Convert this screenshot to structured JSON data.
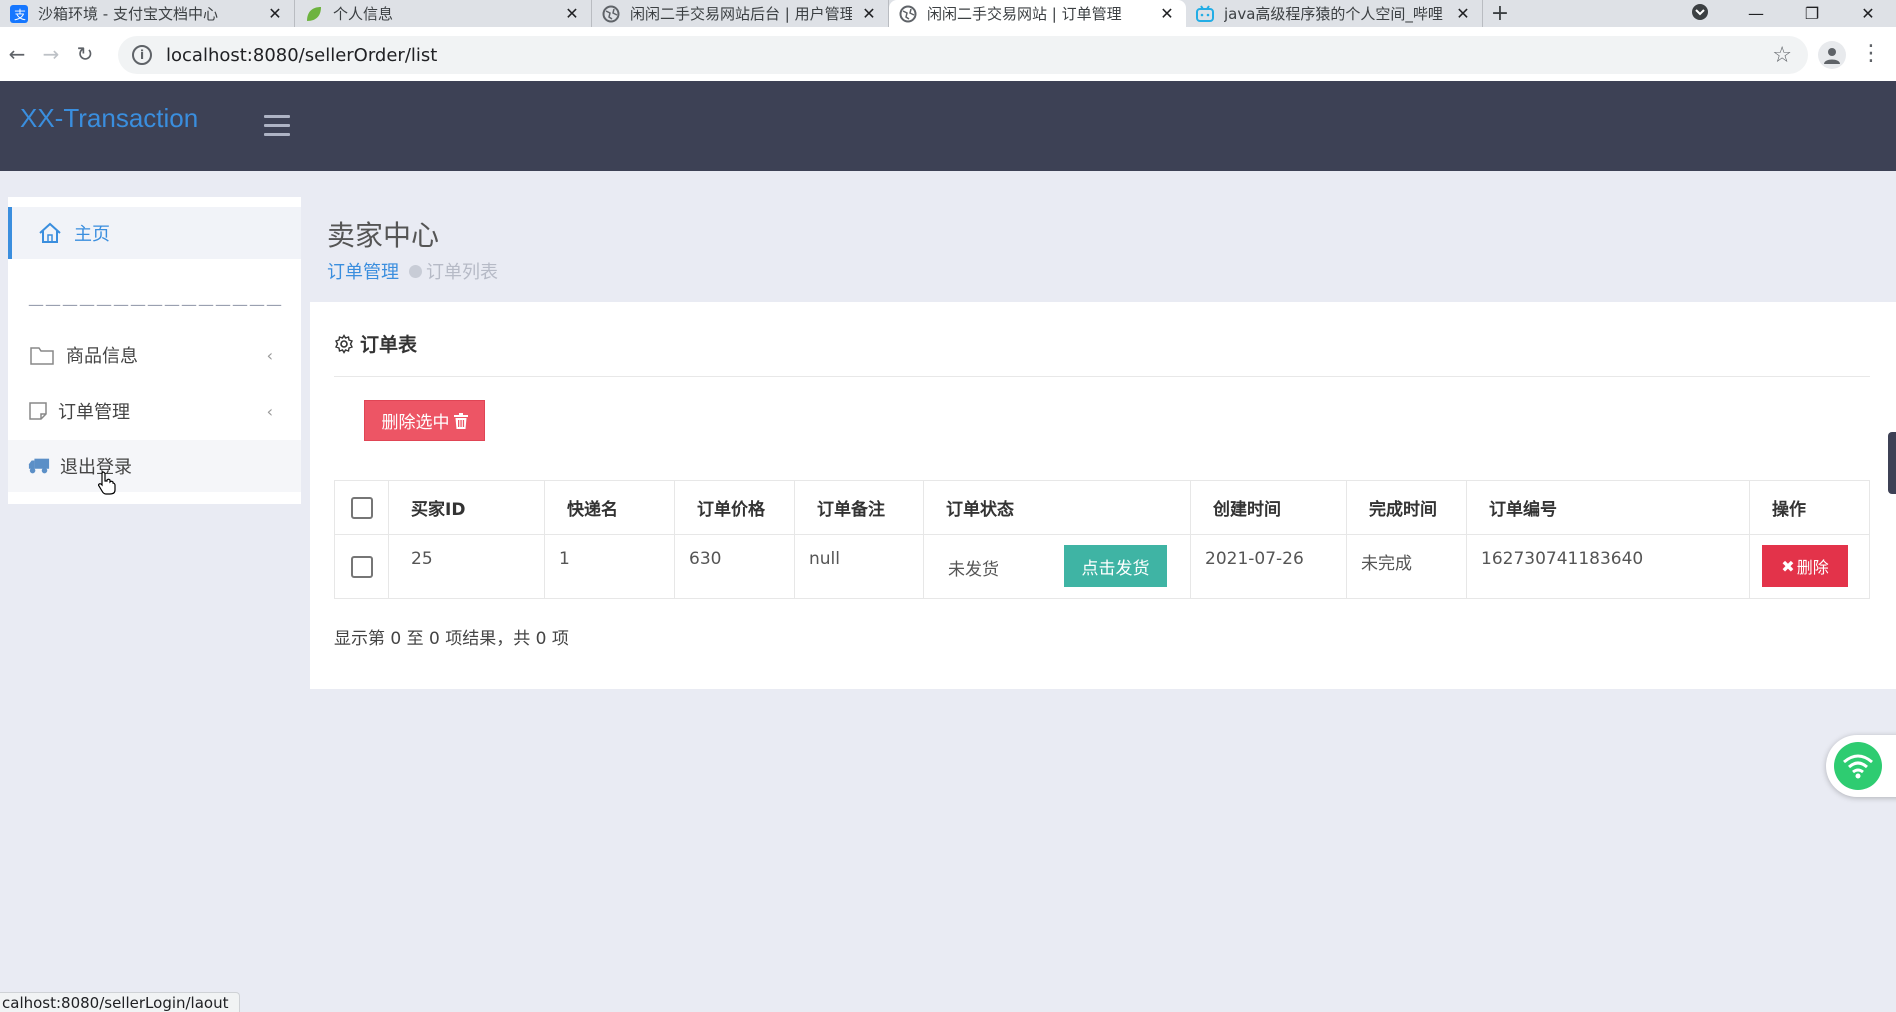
{
  "browser": {
    "tabs": [
      {
        "title": "沙箱环境 - 支付宝文档中心",
        "active": false
      },
      {
        "title": "个人信息",
        "active": false
      },
      {
        "title": "闲闲二手交易网站后台 | 用户管理",
        "active": false
      },
      {
        "title": "闲闲二手交易网站 | 订单管理",
        "active": true
      },
      {
        "title": "java高级程序猿的个人空间_哔哩",
        "active": false
      }
    ],
    "url": "localhost:8080/sellerOrder/list",
    "status_url": "calhost:8080/sellerLogin/laout"
  },
  "header": {
    "brand": "XX-Transaction"
  },
  "sidebar": {
    "home": "主页",
    "divider": "———————————————",
    "goods": "商品信息",
    "orders": "订单管理",
    "logout": "退出登录"
  },
  "page": {
    "title": "卖家中心",
    "breadcrumb_parent": "订单管理",
    "breadcrumb_current": "订单列表"
  },
  "card": {
    "title": "订单表",
    "delete_selected": "删除选中"
  },
  "table": {
    "columns": [
      "买家ID",
      "快递名",
      "订单价格",
      "订单备注",
      "订单状态",
      "创建时间",
      "完成时间",
      "订单编号",
      "操作"
    ],
    "rows": [
      {
        "buyer_id": "25",
        "courier": "1",
        "price": "630",
        "remark": "null",
        "status": "未发货",
        "ship_button": "点击发货",
        "created": "2021-07-26",
        "finished": "未完成",
        "order_no": "162730741183640",
        "delete_button": "删除"
      }
    ],
    "info": "显示第 0 至 0 项结果，共 0 项"
  },
  "colors": {
    "header_bg": "#3d4155",
    "brand": "#3a8ede",
    "danger": "#ed5565",
    "ship": "#3fb4a4"
  }
}
